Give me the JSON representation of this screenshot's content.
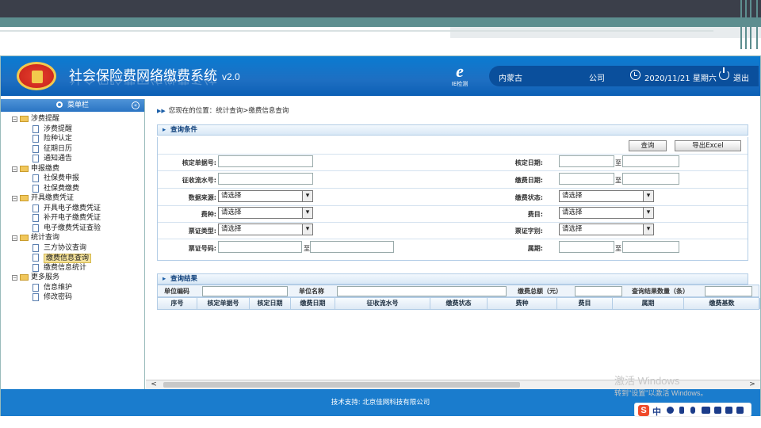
{
  "app": {
    "title": "社会保险费网络缴费系统",
    "version": "v2.0",
    "ie_label": "IE检测",
    "org_name": "内蒙古",
    "org_suffix": "公司",
    "datetime": "2020/11/21 星期六",
    "logout": "退出"
  },
  "sidebar": {
    "header": "菜单栏",
    "groups": [
      {
        "label": "涉费提醒",
        "items": [
          "涉费提醒",
          "险种认定",
          "征期日历",
          "通知通告"
        ]
      },
      {
        "label": "申报缴费",
        "items": [
          "社保费申报",
          "社保费缴费"
        ]
      },
      {
        "label": "开具缴费凭证",
        "items": [
          "开具电子缴费凭证",
          "补开电子缴费凭证",
          "电子缴费凭证查验"
        ]
      },
      {
        "label": "统计查询",
        "items": [
          "三方协议查询",
          "缴费信息查询",
          "缴费信息统计"
        ]
      },
      {
        "label": "更多服务",
        "items": [
          "信息维护",
          "修改密码"
        ]
      }
    ],
    "selected": "缴费信息查询"
  },
  "main": {
    "breadcrumb": "您现在的位置：统计查询>缴费信息查询",
    "query_section": "查询条件",
    "query_button": "查询",
    "export_button": "导出Excel",
    "to_label": "至",
    "fields": {
      "hd_no": "核定单据号:",
      "zs_serial": "征收流水号:",
      "data_source": "数据来源:",
      "fee_type": "费种:",
      "voucher_type": "票证类型:",
      "voucher_no": "票证号码:",
      "hd_date": "核定日期:",
      "pay_date": "缴费日期:",
      "pay_status": "缴费状态:",
      "fee_item": "费目:",
      "voucher_char": "票证字别:",
      "period": "属期:"
    },
    "select_placeholder": "请选择",
    "result_section": "查询结果",
    "summary": {
      "unit_code": "单位编码",
      "unit_name": "单位名称",
      "total_amount": "缴费总额（元）",
      "result_count": "查询结果数量（条）"
    },
    "columns": [
      "序号",
      "核定单据号",
      "核定日期",
      "缴费日期",
      "征收流水号",
      "缴费状态",
      "费种",
      "费目",
      "属期",
      "缴费基数"
    ]
  },
  "footer": {
    "text": "技术支持: 北京佳网科技有限公司"
  },
  "os": {
    "watermark": "激活 Windows",
    "watermark_sub": "转到\"设置\"以激活 Windows。",
    "ime_label": "中"
  },
  "colors": {
    "header_blue": "#1e6fc2",
    "footer_blue": "#1a7ccd",
    "deco_teal": "#5d8e8f",
    "deco_dark": "#3b3f4a"
  }
}
